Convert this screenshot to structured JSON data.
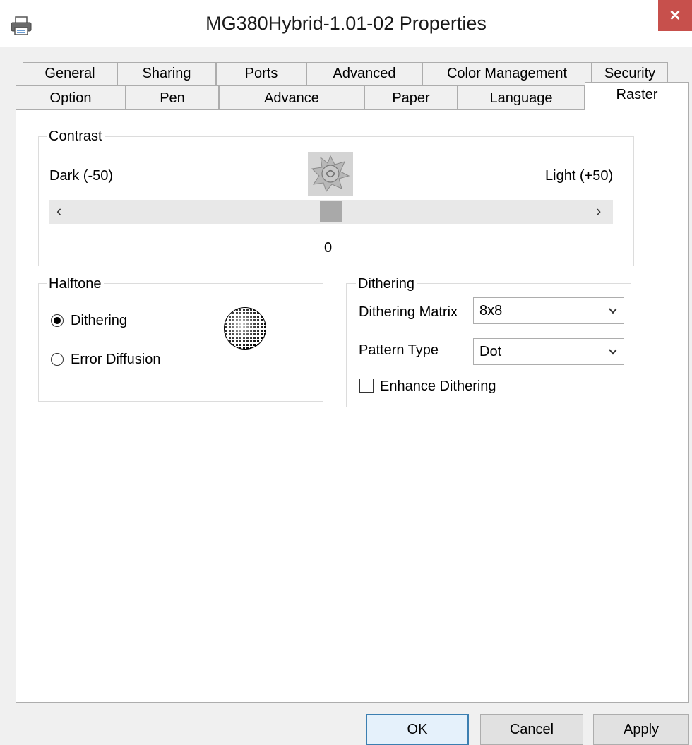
{
  "window": {
    "title": "MG380Hybrid-1.01-02 Properties",
    "close_glyph": "×"
  },
  "icons": {
    "app": "printer-icon",
    "close": "close-icon",
    "contrast": "contrast-rose-icon",
    "halftone": "halftone-dot-icon",
    "slider_left": "chevron-left-icon",
    "slider_right": "chevron-right-icon",
    "dropdown": "chevron-down-icon"
  },
  "tabs": {
    "row1": [
      "General",
      "Sharing",
      "Ports",
      "Advanced",
      "Color Management",
      "Security"
    ],
    "row2": [
      "Option",
      "Pen",
      "Advance",
      "Paper",
      "Language",
      "Raster"
    ],
    "active": "Raster"
  },
  "contrast": {
    "legend": "Contrast",
    "left_label": "Dark (-50)",
    "right_label": "Light (+50)",
    "value_text": "0",
    "min": -50,
    "max": 50,
    "value": 0,
    "left_arrow": "‹",
    "right_arrow": "›"
  },
  "halftone": {
    "legend": "Halftone",
    "options": [
      "Dithering",
      "Error Diffusion"
    ],
    "selected": "Dithering"
  },
  "dithering": {
    "legend": "Dithering",
    "matrix_label": "Dithering Matrix",
    "matrix_value": "8x8",
    "pattern_label": "Pattern Type",
    "pattern_value": "Dot",
    "enhance_label": "Enhance Dithering",
    "enhance_checked": false
  },
  "buttons": {
    "ok": "OK",
    "cancel": "Cancel",
    "apply": "Apply"
  },
  "colors": {
    "close_button": "#c7504c",
    "default_button_border": "#3c7fb1"
  }
}
